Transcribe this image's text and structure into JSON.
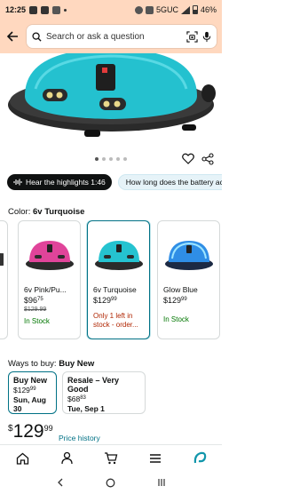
{
  "status_bar": {
    "time": "12:25",
    "network": "5GUC",
    "battery": "46%"
  },
  "search": {
    "placeholder": "Search or ask a question"
  },
  "carousel": {
    "count": 5,
    "active_index": 0
  },
  "highlights": {
    "hear_label": "Hear the highlights 1:46",
    "ask_label": "How long does the battery ac"
  },
  "color": {
    "label": "Color:",
    "selected": "6v Turquoise"
  },
  "variants": [
    {
      "name": "",
      "price_whole": "",
      "price_frac": "",
      "list_price": "",
      "stock": "",
      "stock_kind": "",
      "color": "#5a5a5a"
    },
    {
      "name": "6v Pink/Pu...",
      "price_whole": "$96",
      "price_frac": "75",
      "list_price": "$129.99",
      "stock": "In Stock",
      "stock_kind": "ok",
      "color": "#e0449a"
    },
    {
      "name": "6v Turquoise",
      "price_whole": "$129",
      "price_frac": "99",
      "list_price": "",
      "stock": "Only 1 left in stock - order...",
      "stock_kind": "warn",
      "color": "#25c3d0"
    },
    {
      "name": "Glow Blue",
      "price_whole": "$129",
      "price_frac": "99",
      "list_price": "",
      "stock": "In Stock",
      "stock_kind": "ok",
      "color": "#2f8ee6"
    }
  ],
  "ways_to_buy": {
    "label": "Ways to buy:",
    "selected": "Buy New"
  },
  "buy_options": [
    {
      "title": "Buy New",
      "price_whole": "$129",
      "price_frac": "99",
      "delivery": "Sun, Aug 30"
    },
    {
      "title": "Resale – Very Good",
      "price_whole": "$68",
      "price_frac": "83",
      "delivery": "Tue, Sep 1"
    }
  ],
  "price": {
    "currency": "$",
    "whole": "129",
    "fraction": "99",
    "history_link": "Price history"
  },
  "colors": {
    "header_bg": "#ffd8bf",
    "link": "#007185",
    "in_stock": "#007600",
    "low_stock": "#b12704",
    "product_body": "#25c3d0"
  }
}
